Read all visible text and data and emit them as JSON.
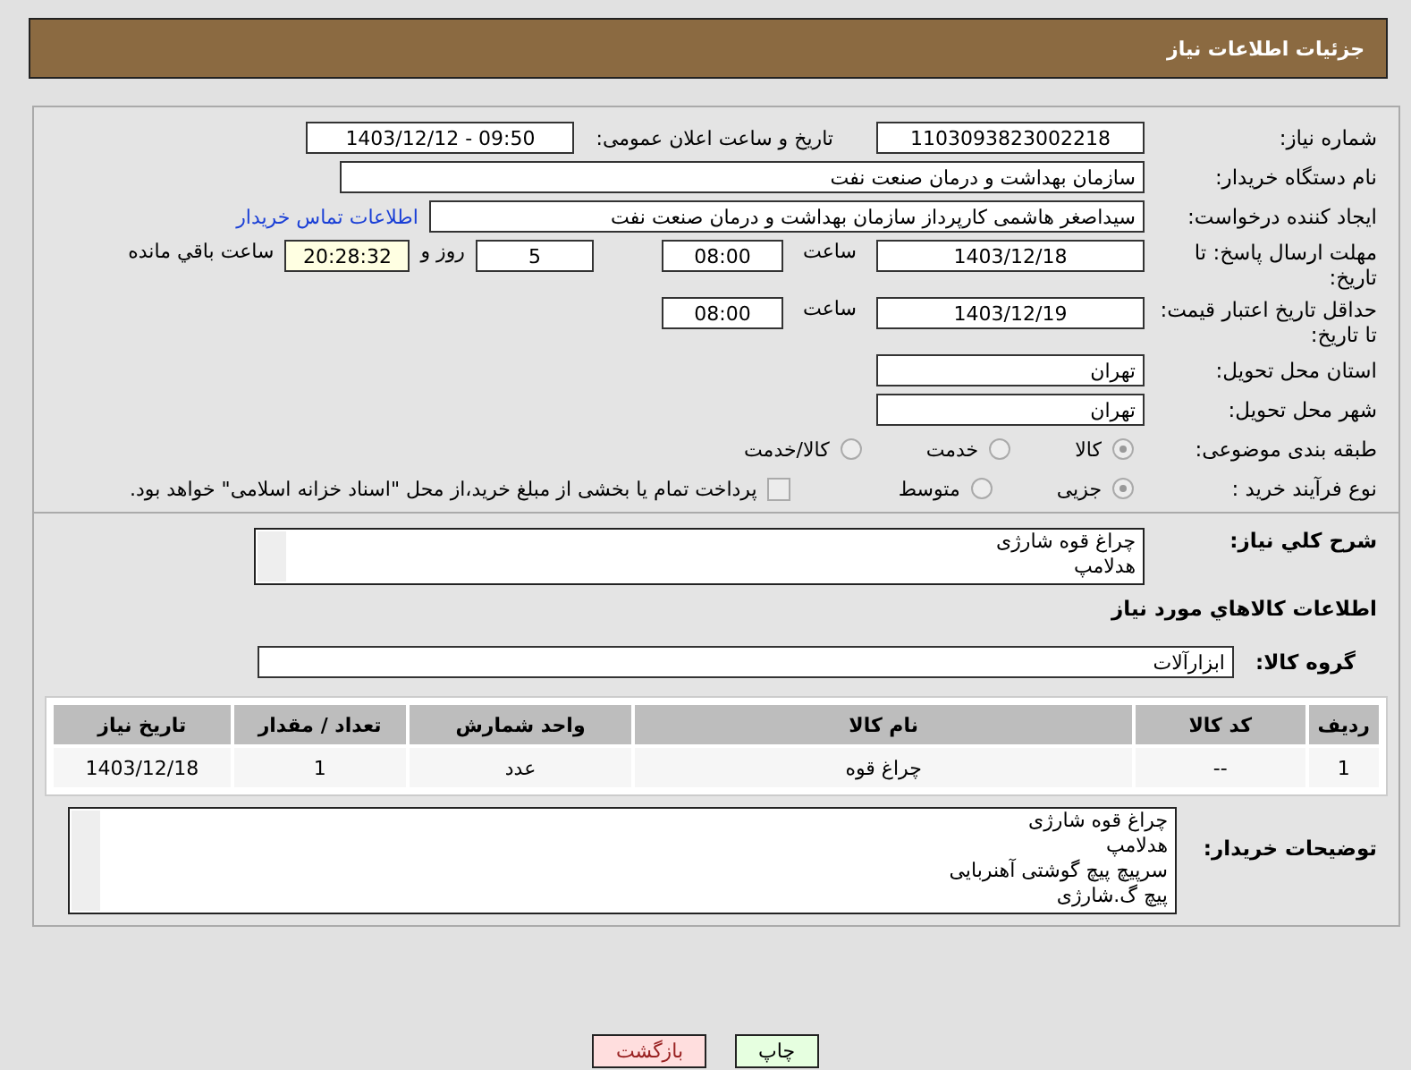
{
  "header": {
    "title": "جزئیات اطلاعات نیاز"
  },
  "need_number": {
    "label": "شماره نیاز:",
    "value": "1103093823002218"
  },
  "announce": {
    "label": "تاریخ و ساعت اعلان عمومی:",
    "value": "1403/12/12 - 09:50"
  },
  "buyer_org": {
    "label": "نام دستگاه خریدار:",
    "value": "سازمان بهداشت و درمان صنعت نفت"
  },
  "requester": {
    "label": "ایجاد کننده درخواست:",
    "value": "سیداصغر هاشمی کارپرداز سازمان بهداشت و درمان صنعت نفت",
    "link": "اطلاعات تماس خریدار"
  },
  "reply_deadline": {
    "label": "مهلت ارسال پاسخ: تا تاریخ:",
    "date": "1403/12/18",
    "time_label": "ساعت",
    "time": "08:00",
    "days": "5",
    "days_label": "روز و",
    "remaining": "20:28:32",
    "remaining_label": "ساعت باقي مانده"
  },
  "price_validity": {
    "label": "حداقل تاریخ اعتبار قیمت: تا تاریخ:",
    "date": "1403/12/19",
    "time_label": "ساعت",
    "time": "08:00"
  },
  "province": {
    "label": "استان محل تحویل:",
    "value": "تهران"
  },
  "city": {
    "label": "شهر محل تحویل:",
    "value": "تهران"
  },
  "category": {
    "label": "طبقه بندی موضوعی:",
    "options": [
      {
        "label": "کالا",
        "selected": true
      },
      {
        "label": "خدمت",
        "selected": false
      },
      {
        "label": "کالا/خدمت",
        "selected": false
      }
    ]
  },
  "purchase_type": {
    "label": "نوع فرآیند خرید :",
    "options": [
      {
        "label": "جزیی",
        "selected": true
      },
      {
        "label": "متوسط",
        "selected": false
      }
    ],
    "payment": {
      "label": "پرداخت تمام یا بخشی از مبلغ خرید،از محل \"اسناد خزانه اسلامی\" خواهد بود.",
      "checked": false
    }
  },
  "description": {
    "label": "شرح کلي نياز:",
    "lines": [
      "چراغ قوه شارژی",
      "هدلامپ"
    ]
  },
  "goods_heading": "اطلاعات کالاهاي مورد نياز",
  "goods_group": {
    "label": "گروه کالا:",
    "value": "ابزارآلات"
  },
  "table": {
    "columns": [
      "ردیف",
      "کد کالا",
      "نام کالا",
      "واحد شمارش",
      "تعداد / مقدار",
      "تاریخ نیاز"
    ],
    "rows": [
      [
        "1",
        "--",
        "چراغ قوه",
        "عدد",
        "1",
        "1403/12/18"
      ]
    ]
  },
  "buyer_notes": {
    "label": "توضیحات خریدار:",
    "lines": [
      "چراغ قوه شارژی",
      "هدلامپ",
      "سرپیچ پیچ گوشتی آهنربایی",
      "پیچ گ.شارژی"
    ]
  },
  "buttons": [
    {
      "label": "چاپ",
      "kind": "print"
    },
    {
      "label": "بازگشت",
      "kind": "back"
    }
  ]
}
